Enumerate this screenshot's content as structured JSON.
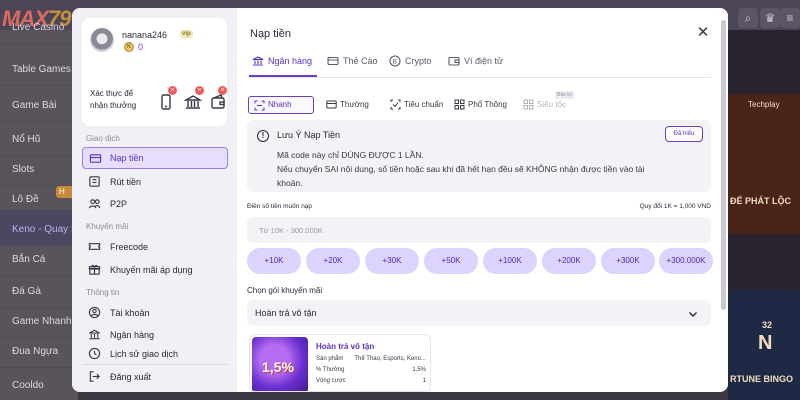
{
  "background": {
    "logo_text": "MAX",
    "logo_num": "79",
    "nav_items": [
      "Live Casino",
      "Table Games",
      "Game Bài",
      "Nổ Hũ",
      "Slots",
      "Lô Đề",
      "Keno - Quay Số",
      "Bắn Cá",
      "Đá Gà",
      "Game Nhanh",
      "Đua Ngựa",
      "Cooldo"
    ],
    "chip": "H",
    "card_texts": [
      "Techplay",
      "ĐỂ PHÁT LỘC",
      "32",
      "N",
      "RTUNE BINGO"
    ]
  },
  "menu": {
    "username": "nanana246",
    "vip_badge": "vip",
    "balance": "0",
    "verify_label": "Xác thực để nhận thưởng",
    "sections": {
      "transactions": "Giao dịch",
      "promotions": "Khuyến mãi",
      "info": "Thông tin"
    },
    "items": {
      "deposit": "Nạp tiền",
      "withdraw": "Rút tiền",
      "p2p": "P2P",
      "freecode": "Freecode",
      "applied_promos": "Khuyến mãi áp dụng",
      "account": "Tài khoản",
      "bank": "Ngân hàng",
      "history": "Lịch sử giao dịch",
      "logout": "Đăng xuất"
    }
  },
  "content": {
    "title": "Nạp tiền",
    "tabs": [
      "Ngân hàng",
      "Thẻ Cào",
      "Crypto",
      "Ví điện tử"
    ],
    "methods": [
      "Nhanh",
      "Thường",
      "Tiêu chuẩn",
      "Phổ Thông",
      "Siêu tốc"
    ],
    "soon_badge": "Bảo trì",
    "notice": {
      "title": "Lưu Ý Nạp Tiền",
      "line1": "Mã code này chỉ DÙNG ĐƯỢC 1 LẦN.",
      "line2": "Nếu chuyển SAI nội dung, số tiền hoặc sau khi đã hết hạn đều sẽ KHÔNG nhận được tiền vào tài",
      "line3": "khoản.",
      "understood_button": "Đã hiểu"
    },
    "amount_label": "Điền số tiền muốn nạp",
    "rate_label": "Quy đổi 1K = 1,000 VND",
    "amount_placeholder": "Từ 10K - 300.000K",
    "amount_chips": [
      "+10K",
      "+20K",
      "+30K",
      "+50K",
      "+100K",
      "+200K",
      "+300K",
      "+300.000K"
    ],
    "promo_label": "Chọn gói khuyến mãi",
    "promo_selected": "Hoàn trả vô tận",
    "promo_card": {
      "image_text": "1,5%",
      "title": "Hoàn trả vô tận",
      "rows": [
        {
          "label": "Sản phẩm",
          "value": "Thể Thao, Esports, Keno..."
        },
        {
          "label": "% Thưởng",
          "value": "1,5%"
        },
        {
          "label": "Vòng cược",
          "value": "1"
        }
      ]
    }
  },
  "colors": {
    "accent": "#6a3fd0",
    "chip_bg": "#ddd3ff",
    "menu_bg": "#f1f0f5",
    "badge_red": "#f05a5a"
  }
}
